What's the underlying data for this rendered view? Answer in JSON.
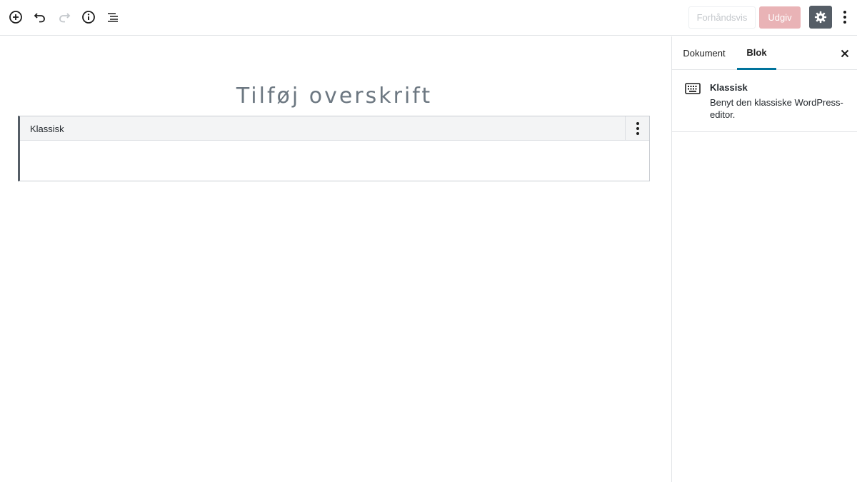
{
  "toolbar": {
    "preview_label": "Forhåndsvis",
    "publish_label": "Udgiv",
    "icons": [
      "plus-circle-icon",
      "undo-icon",
      "redo-icon",
      "info-icon",
      "list-outline-icon",
      "gear-icon",
      "ellipsis-vertical-icon"
    ]
  },
  "editor": {
    "title_placeholder": "Tilføj overskrift",
    "classic_block_label": "Klassisk"
  },
  "sidebar": {
    "tabs": [
      {
        "label": "Dokument",
        "active": false
      },
      {
        "label": "Blok",
        "active": true
      }
    ],
    "block": {
      "icon": "keyboard-icon",
      "name": "Klassisk",
      "description": "Benyt den klassiske WordPress-editor."
    }
  },
  "colors": {
    "accent_tab": "#00739c",
    "publish_disabled": "#e9b3b6",
    "settings_active": "#555d66"
  }
}
